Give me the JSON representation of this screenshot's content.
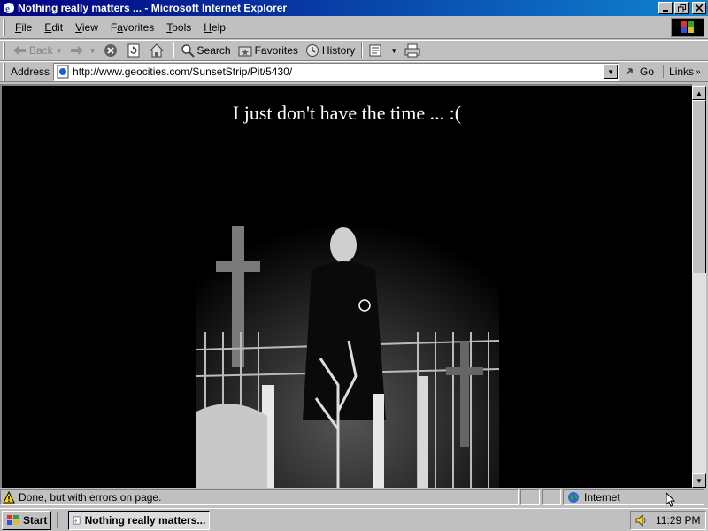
{
  "window": {
    "title": "Nothing really matters ... - Microsoft Internet Explorer",
    "min_icon": "minimize-icon",
    "max_icon": "restore-icon",
    "close_icon": "close-icon"
  },
  "menu": {
    "items": [
      {
        "label": "File",
        "key": "F",
        "rest": "ile"
      },
      {
        "label": "Edit",
        "key": "E",
        "rest": "dit"
      },
      {
        "label": "View",
        "key": "V",
        "rest": "iew"
      },
      {
        "label": "Favorites",
        "key": "a",
        "pre": "F",
        "rest": "vorites"
      },
      {
        "label": "Tools",
        "key": "T",
        "rest": "ools"
      },
      {
        "label": "Help",
        "key": "H",
        "rest": "elp"
      }
    ]
  },
  "toolbar": {
    "back": "Back",
    "search": "Search",
    "favorites": "Favorites",
    "history": "History"
  },
  "address": {
    "label": "Address",
    "url": "http://www.geocities.com/SunsetStrip/Pit/5430/",
    "go": "Go",
    "links": "Links"
  },
  "page": {
    "heading": "I just don't have the time ... :("
  },
  "status": {
    "message": "Done, but with errors on page.",
    "zone": "Internet"
  },
  "taskbar": {
    "start": "Start",
    "task": "Nothing really matters...",
    "clock": "11:29 PM"
  },
  "colors": {
    "titlebar_start": "#000080",
    "titlebar_end": "#1084d0",
    "page_background": "#000000",
    "page_text": "#ffffff"
  }
}
